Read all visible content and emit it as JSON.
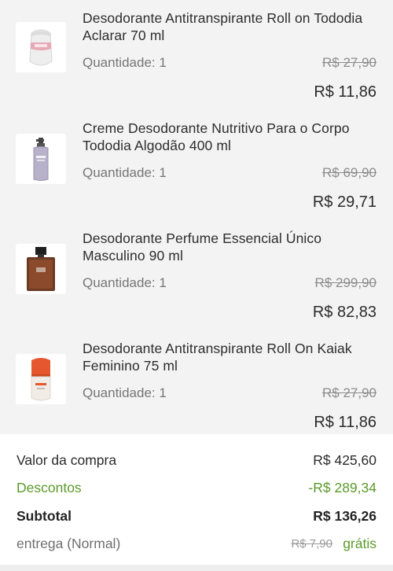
{
  "products": [
    {
      "name": "Desodorante Antitranspirante Roll on Tododia Aclarar 70 ml",
      "quantity": "Quantidade: 1",
      "old_price": "R$ 27,90",
      "price": "R$ 11,86",
      "image": "roll-on-white-pink"
    },
    {
      "name": "Creme Desodorante Nutritivo Para o Corpo Tododia Algodão 400 ml",
      "quantity": "Quantidade: 1",
      "old_price": "R$ 69,90",
      "price": "R$ 29,71",
      "image": "lotion-pump-bottle"
    },
    {
      "name": "Desodorante Perfume Essencial Único Masculino 90 ml",
      "quantity": "Quantidade: 1",
      "old_price": "R$ 299,90",
      "price": "R$ 82,83",
      "image": "perfume-bottle-brown"
    },
    {
      "name": "Desodorante Antitranspirante Roll On Kaiak Feminino 75 ml",
      "quantity": "Quantidade: 1",
      "old_price": "R$ 27,90",
      "price": "R$ 11,86",
      "image": "roll-on-orange"
    }
  ],
  "summary": {
    "purchase_label": "Valor da compra",
    "purchase_value": "R$ 425,60",
    "discount_label": "Descontos",
    "discount_value": "-R$ 289,34",
    "subtotal_label": "Subtotal",
    "subtotal_value": "R$ 136,26",
    "shipping_label": "entrega (Normal)",
    "shipping_old": "R$ 7,90",
    "shipping_value": "grátis"
  },
  "colors": {
    "background": "#f3f3f3",
    "discount_green": "#5a9a2a",
    "text_dark": "#2b2b2b",
    "text_muted": "#767676"
  }
}
